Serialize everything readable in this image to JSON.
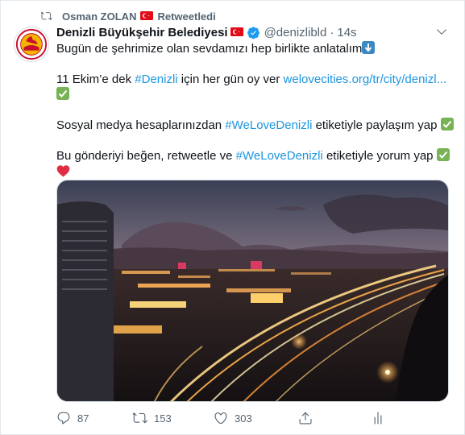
{
  "retweet": {
    "user": "Osman ZOLAN",
    "label": "Retweetledi"
  },
  "author": {
    "name": "Denizli Büyükşehir Belediyesi",
    "handle": "@denizlibld",
    "sep": "·",
    "time": "14s"
  },
  "tweet": {
    "line1": "Bugün de şehrimize olan sevdamızı hep birlikte anlatalım",
    "line2_a": "11 Ekim’e dek ",
    "line2_tag": "#Denizli",
    "line2_b": " için her gün oy ver ",
    "line2_link": "welovecities.org/tr/city/denizl...",
    "line3_a": "Sosyal medya hesaplarınızdan ",
    "line3_tag": "#WeLoveDenizli",
    "line3_b": " etiketiyle paylaşım yap",
    "line4_a": "Bu gönderiyi beğen, retweetle ve ",
    "line4_tag": "#WeLoveDenizli",
    "line4_b": " etiketiyle yorum yap"
  },
  "stats": {
    "replies": "87",
    "retweets": "153",
    "likes": "303"
  },
  "icons": {
    "retweet": "retweet-icon",
    "flag": "turkey-flag-icon",
    "verified": "verified-badge-icon",
    "caret": "chevron-down-icon",
    "reply": "reply-icon",
    "like": "heart-icon",
    "share": "share-icon",
    "analytics": "analytics-icon",
    "emoji_down": "down-arrow-emoji",
    "emoji_check": "check-mark-emoji",
    "emoji_heart": "red-heart-emoji"
  },
  "colors": {
    "link": "#1b95e0",
    "secondary": "#536471",
    "verified": "#1d9bf0",
    "flag": "#e30a17"
  }
}
